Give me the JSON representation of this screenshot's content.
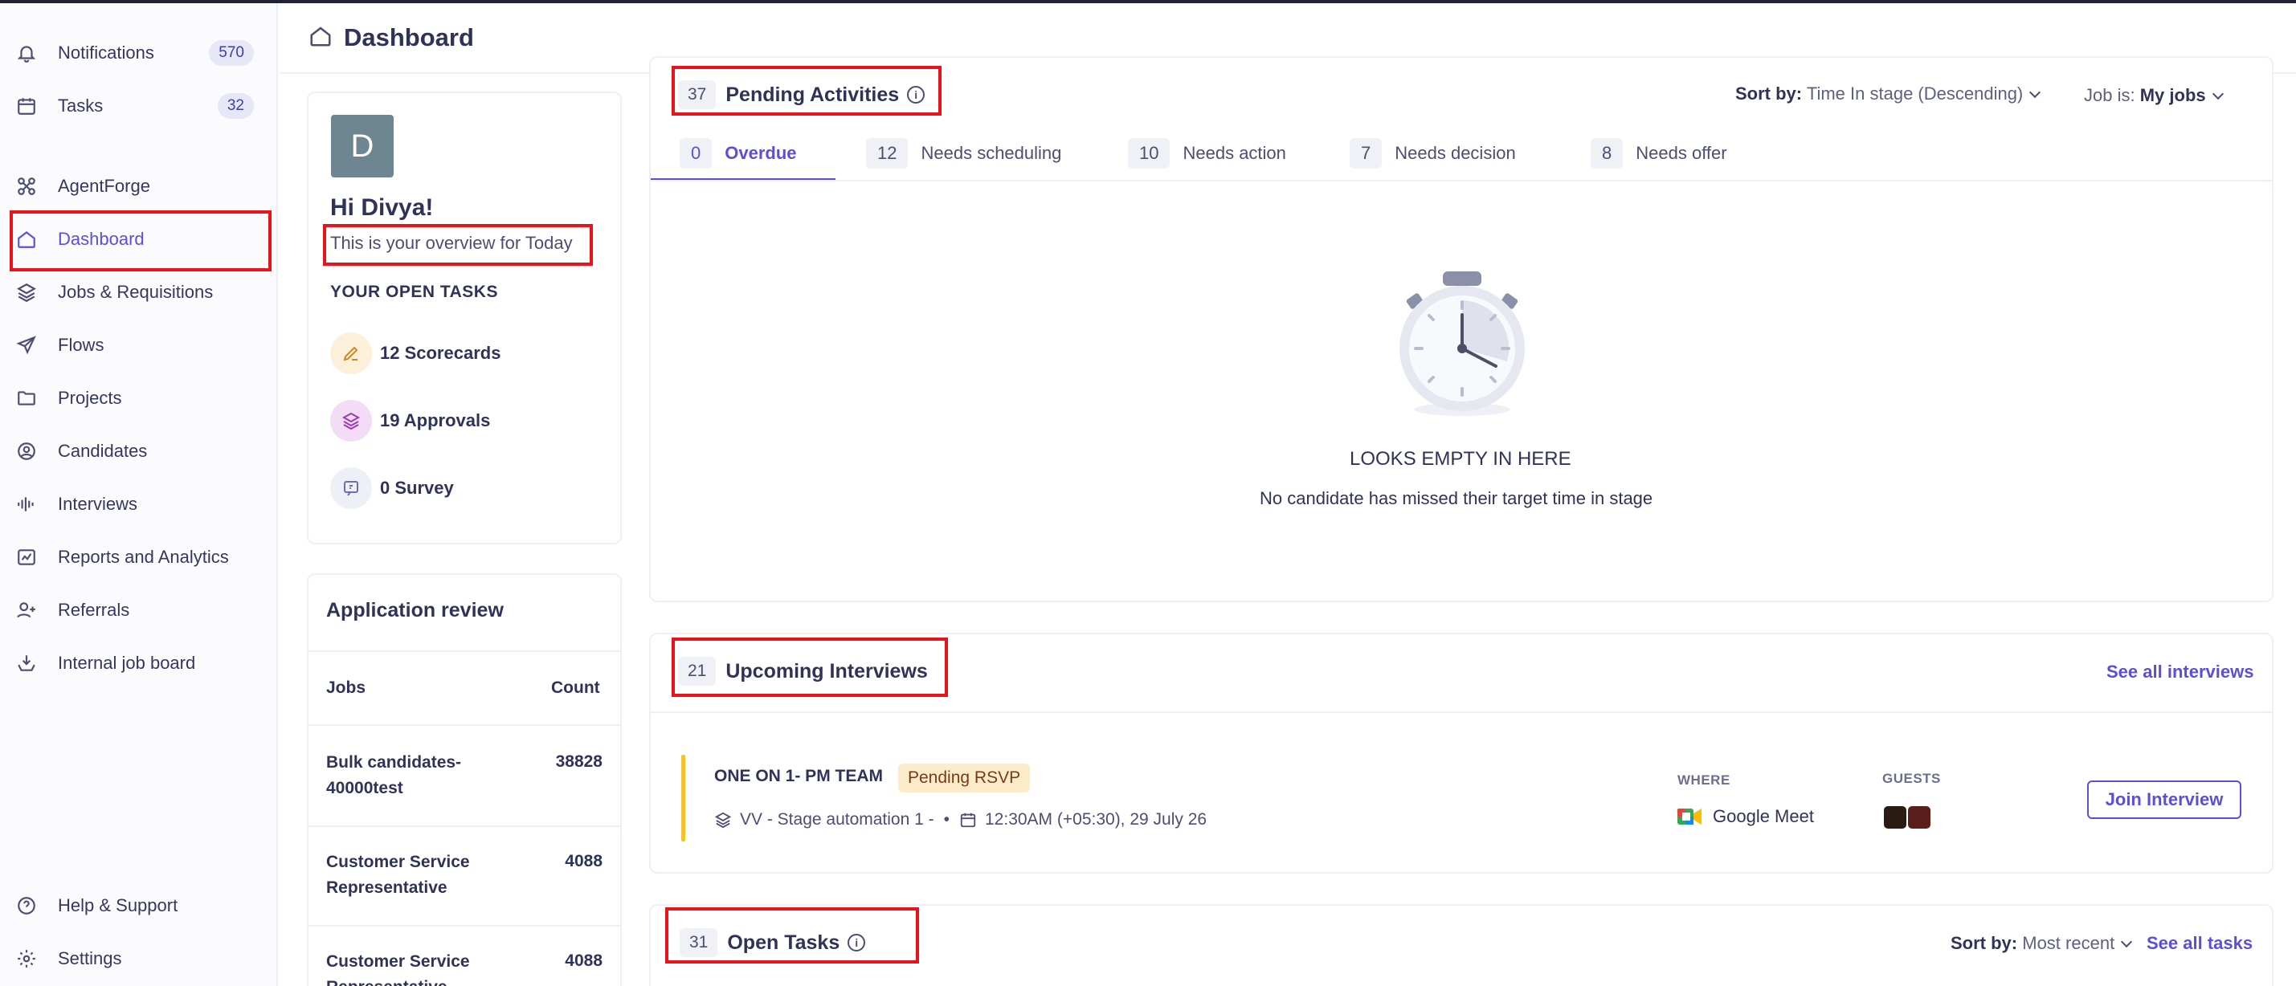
{
  "header": {
    "title": "Dashboard"
  },
  "sidebar": {
    "items": [
      {
        "label": "Notifications",
        "badge": "570"
      },
      {
        "label": "Tasks",
        "badge": "32"
      },
      {
        "label": "AgentForge"
      },
      {
        "label": "Dashboard"
      },
      {
        "label": "Jobs & Requisitions"
      },
      {
        "label": "Flows"
      },
      {
        "label": "Projects"
      },
      {
        "label": "Candidates"
      },
      {
        "label": "Interviews"
      },
      {
        "label": "Reports and Analytics"
      },
      {
        "label": "Referrals"
      },
      {
        "label": "Internal job board"
      },
      {
        "label": "Help & Support"
      },
      {
        "label": "Settings"
      }
    ]
  },
  "profile": {
    "avatar_letter": "D",
    "greeting": "Hi Divya!",
    "overview": "This is your overview for Today",
    "open_tasks_heading": "YOUR OPEN TASKS",
    "tasks": [
      {
        "label": "12 Scorecards"
      },
      {
        "label": "19 Approvals"
      },
      {
        "label": "0 Survey"
      }
    ]
  },
  "application_review": {
    "title": "Application review",
    "col_jobs": "Jobs",
    "col_count": "Count",
    "rows": [
      {
        "job": "Bulk candidates-40000test",
        "count": "38828"
      },
      {
        "job": "Customer Service Representative",
        "count": "4088"
      },
      {
        "job": "Customer Service Representative",
        "count": "4088"
      }
    ]
  },
  "pending": {
    "count": "37",
    "title": "Pending Activities",
    "sort_label": "Sort by:",
    "sort_value": "Time In stage (Descending)",
    "job_label": "Job is:",
    "job_value": "My jobs",
    "tabs": [
      {
        "n": "0",
        "label": "Overdue"
      },
      {
        "n": "12",
        "label": "Needs scheduling"
      },
      {
        "n": "10",
        "label": "Needs action"
      },
      {
        "n": "7",
        "label": "Needs decision"
      },
      {
        "n": "8",
        "label": "Needs offer"
      }
    ],
    "empty_title": "LOOKS EMPTY IN HERE",
    "empty_sub": "No candidate has missed their target time in stage"
  },
  "interviews": {
    "count": "21",
    "title": "Upcoming Interviews",
    "see_all": "See all interviews",
    "item": {
      "title": "ONE ON 1- PM TEAM",
      "status": "Pending RSVP",
      "job": "VV - Stage automation 1 -",
      "sep": "•",
      "time": "12:30AM (+05:30), 29 July 26",
      "where_label": "WHERE",
      "where": "Google Meet",
      "guests_label": "GUESTS",
      "join": "Join Interview"
    }
  },
  "open_tasks": {
    "count": "31",
    "title": "Open Tasks",
    "sort_label": "Sort by:",
    "sort_value": "Most recent",
    "see_all": "See all tasks"
  },
  "colors": {
    "accent": "#5a4fd6",
    "highlight": "#e8141c",
    "rsvp_bg": "#fdeccc",
    "interview_bar": "#f4c430"
  }
}
